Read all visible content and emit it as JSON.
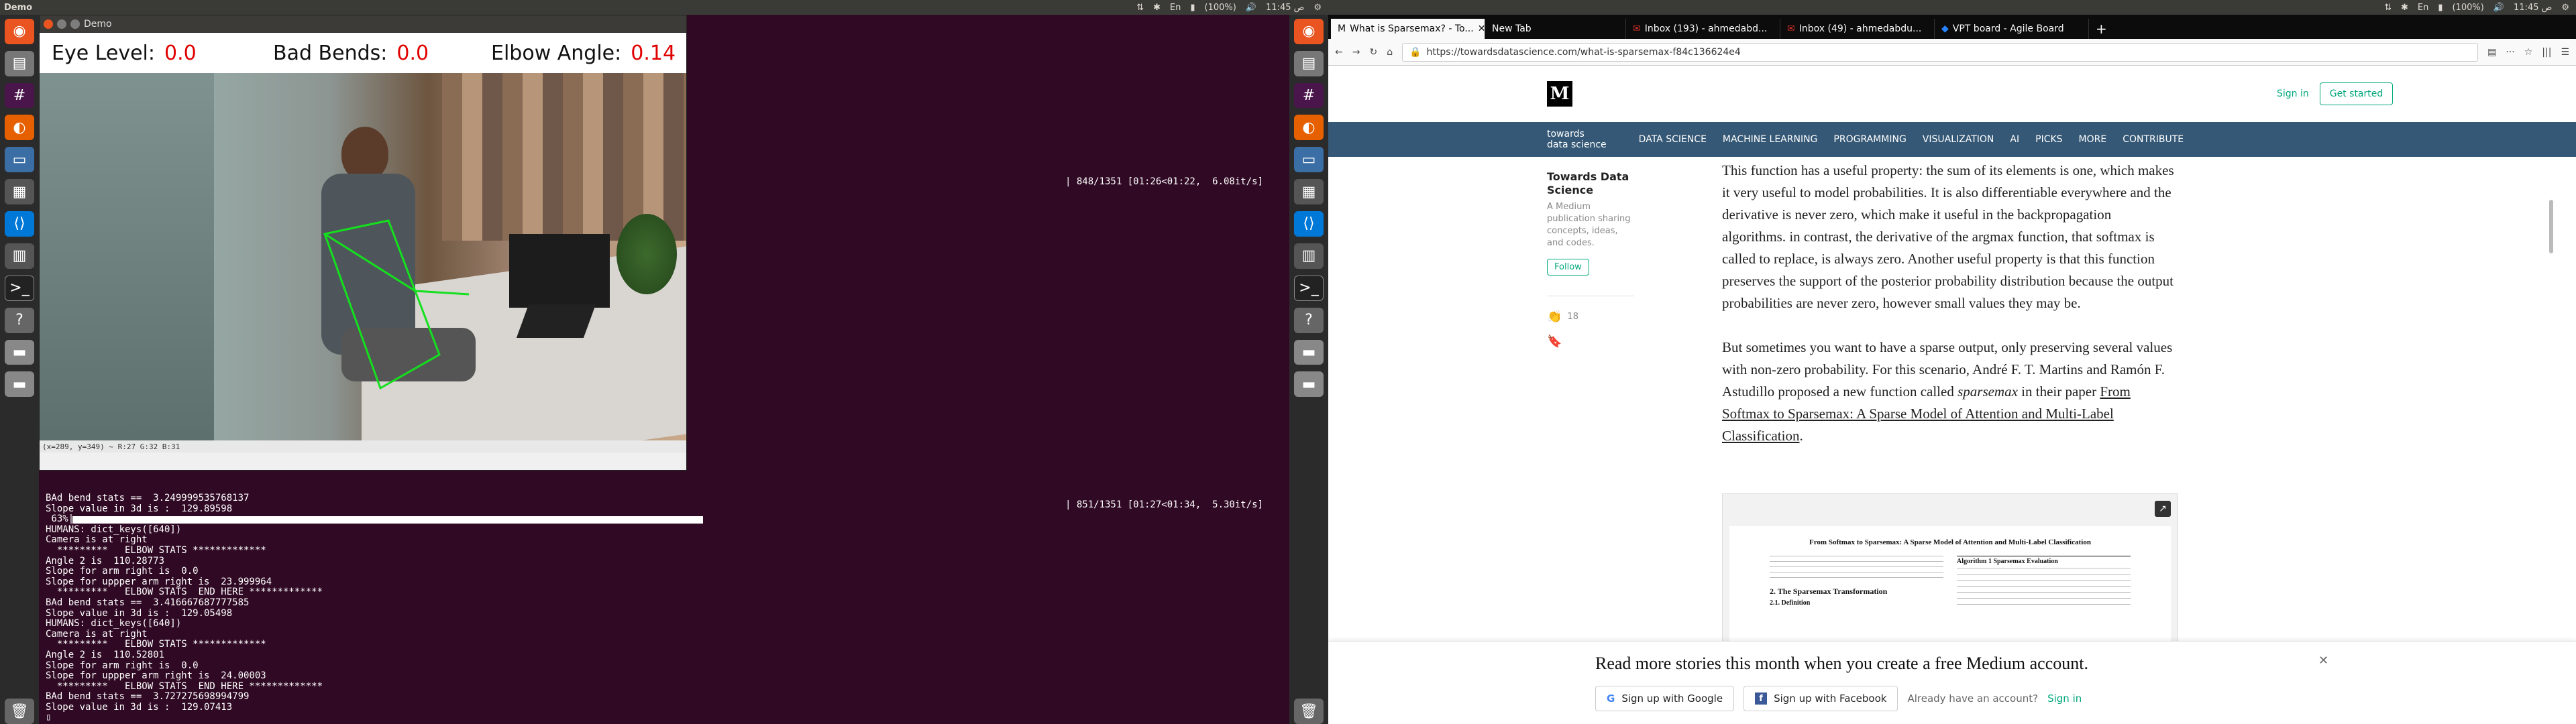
{
  "left_panel": {
    "top_title": "Demo",
    "clock": "11:45 ص",
    "battery": "(100%)",
    "terminal": {
      "progress_top": "| 848/1351 [01:26<01:22,  6.08it/s]",
      "progress_mid": "| 851/1351 [01:27<01:34,  5.30it/s]",
      "progress_pct": " 63%|",
      "lines": [
        "BAd bend stats ==  3.249999535768137",
        "Slope value in 3d is :  129.89598",
        "",
        "HUMANS: dict_keys([640])",
        "Camera is at right",
        "  *********   ELBOW STATS *************",
        "Angle 2 is  110.28773",
        "Slope for arm right is  0.0",
        "Slope for uppper arm right is  23.999964",
        "  *********   ELBOW STATS  END HERE *************",
        "BAd bend stats ==  3.416667687777585",
        "Slope value in 3d is :  129.05498",
        "HUMANS: dict_keys([640])",
        "Camera is at right",
        "  *********   ELBOW STATS *************",
        "Angle 2 is  110.52801",
        "Slope for arm right is  0.0",
        "Slope for uppper arm right is  24.00003",
        "  *********   ELBOW STATS  END HERE *************",
        "BAd bend stats ==  3.727275698994799",
        "Slope value in 3d is :  129.07413"
      ]
    },
    "demo_window": {
      "title": "Demo",
      "eye_label": "Eye Level:",
      "eye_value": "0.0",
      "bend_label": "Bad Bends:",
      "bend_value": "0.0",
      "elbow_label": "Elbow Angle:",
      "elbow_value": "0.14",
      "status": "(x=289, y=349) ~ R:27 G:32 B:31"
    }
  },
  "right_panel": {
    "clock": "11:45 ص",
    "battery": "(100%)",
    "tabs": [
      "What is Sparsemax? - To...",
      "New Tab",
      "Inbox (193) - ahmedabd...",
      "Inbox (49) - ahmedabdu...",
      "VPT board - Agile Board"
    ],
    "url": "https://towardsdatascience.com/what-is-sparsemax-f84c136624e4",
    "signin": "Sign in",
    "get_started": "Get started",
    "brand_top": "towards",
    "brand_bottom": "data science",
    "nav": [
      "DATA SCIENCE",
      "MACHINE LEARNING",
      "PROGRAMMING",
      "VISUALIZATION",
      "AI",
      "PICKS",
      "MORE",
      "CONTRIBUTE"
    ],
    "side_title": "Towards Data Science",
    "side_desc": "A Medium publication sharing concepts, ideas, and codes.",
    "follow": "Follow",
    "claps": "18",
    "para1": "This function has a useful property: the sum of its elements is one, which makes it very useful to model probabilities. It is also differentiable everywhere and the derivative is never zero, which make it useful in the backpropagation algorithms. in contrast, the derivative of the argmax function, that softmax is called to replace, is always zero. Another useful property is that this function preserves the support of the posterior probability distribution because the output probabilities are never zero, however small values they may be.",
    "para2_a": "But sometimes you want to have a sparse output, only preserving several values with non-zero probability. For this scenario, André F. T. Martins and Ramón F. Astudillo proposed a new function called ",
    "para2_em": "sparsemax",
    "para2_b": " in their paper ",
    "para2_link": "From Softmax to Sparsemax: A Sparse Model of Attention and Multi-Label Classification",
    "para2_end": ".",
    "paper_title": "From Softmax to Sparsemax: A Sparse Model of Attention and Multi-Label Classification",
    "paper_section": "2. The Sparsemax Transformation",
    "paper_def": "2.1. Definition",
    "paper_algo": "Algorithm 1 Sparsemax Evaluation",
    "banner_text": "Read more stories this month when you create a free Medium account.",
    "google_btn": "Sign up with Google",
    "facebook_btn": "Sign up with Facebook",
    "already": "Already have an account?",
    "banner_signin": "Sign in"
  }
}
